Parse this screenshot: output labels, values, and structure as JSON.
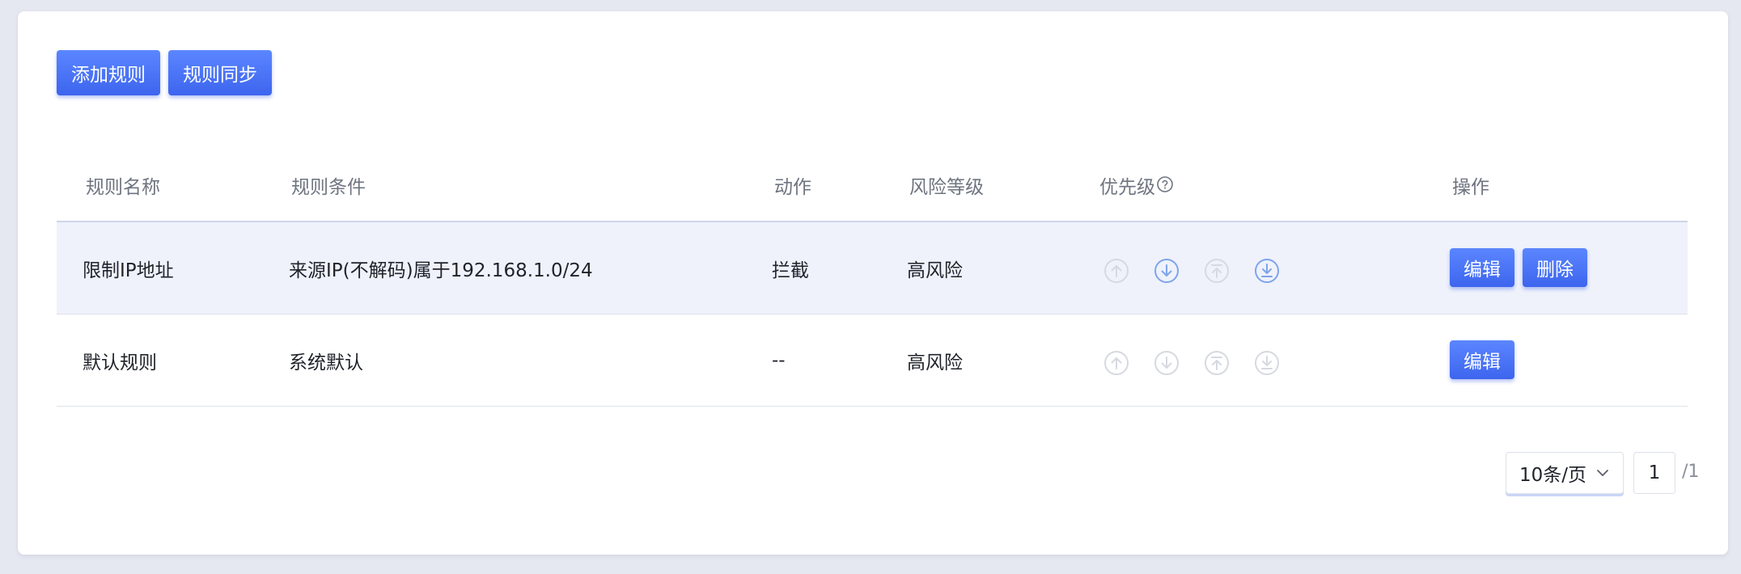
{
  "toolbar": {
    "add_rule_label": "添加规则",
    "sync_rules_label": "规则同步"
  },
  "table": {
    "columns": {
      "name": "规则名称",
      "condition": "规则条件",
      "action": "动作",
      "risk": "风险等级",
      "priority": "优先级",
      "operations": "操作"
    },
    "rows": [
      {
        "name": "限制IP地址",
        "condition": "来源IP(不解码)属于192.168.1.0/24",
        "action": "拦截",
        "risk": "高风险",
        "priority_controls": {
          "move_up": "disabled",
          "move_down": "enabled",
          "move_top": "disabled",
          "move_bottom": "enabled"
        },
        "edit_label": "编辑",
        "delete_label": "删除",
        "highlighted": true
      },
      {
        "name": "默认规则",
        "condition": "系统默认",
        "action": "--",
        "risk": "高风险",
        "priority_controls": {
          "move_up": "disabled",
          "move_down": "disabled",
          "move_top": "disabled",
          "move_bottom": "disabled"
        },
        "edit_label": "编辑",
        "highlighted": false
      }
    ]
  },
  "pagination": {
    "page_size": "10条/页",
    "current_page": "1",
    "total_pages": "/1"
  },
  "colors": {
    "primary": "#4a72f5",
    "enabled_icon": "#7ea4ec",
    "disabled_icon": "#d6d9e0",
    "row_highlight": "#eff2fb",
    "page_bg": "#e6e8f1"
  },
  "icons": [
    "arrow-up-circle-icon",
    "arrow-down-circle-icon",
    "move-top-circle-icon",
    "move-bottom-circle-icon",
    "help-circle-icon",
    "chevron-down-icon"
  ]
}
